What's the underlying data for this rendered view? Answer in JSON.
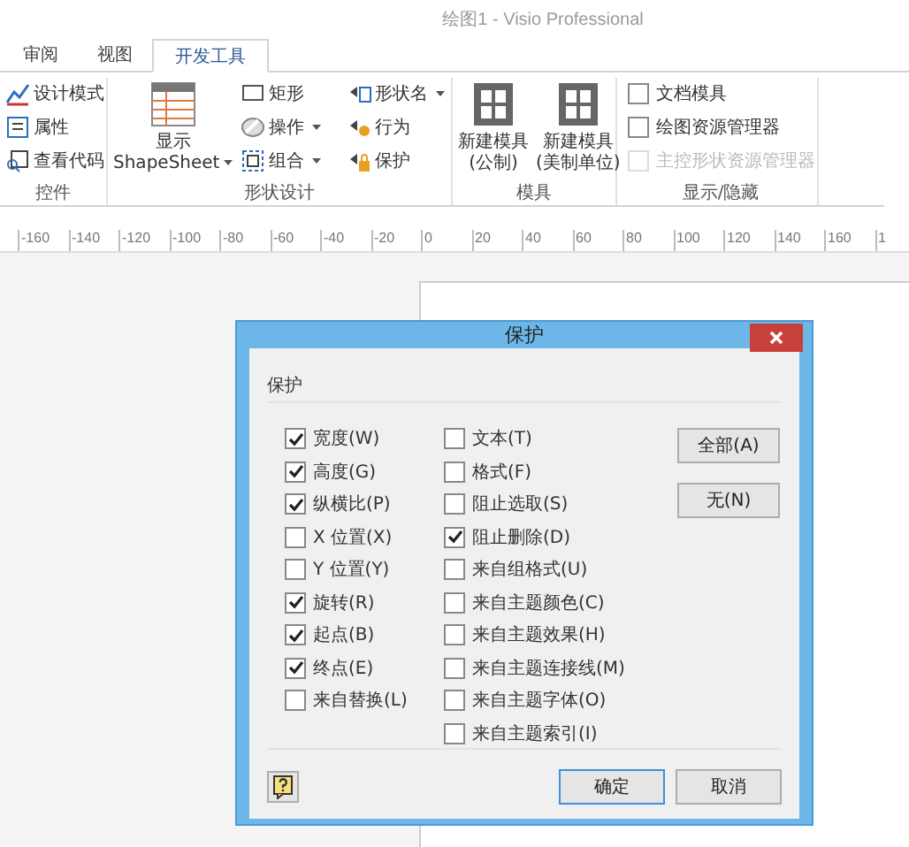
{
  "window": {
    "title": "绘图1 - Visio Professional"
  },
  "tabs": [
    {
      "label": "审阅",
      "selected": false
    },
    {
      "label": "视图",
      "selected": false
    },
    {
      "label": "开发工具",
      "selected": true
    }
  ],
  "ribbon": {
    "groups": [
      {
        "label": "控件",
        "columns": [
          [
            {
              "kind": "small",
              "label": "设计模式",
              "dropdown": false
            },
            {
              "kind": "small",
              "label": "属性",
              "dropdown": false
            },
            {
              "kind": "small",
              "label": "查看代码",
              "dropdown": false
            }
          ]
        ]
      },
      {
        "label": "形状设计",
        "columns": [
          [
            {
              "kind": "large",
              "lines": [
                "显示",
                "ShapeSheet"
              ],
              "dropdown": true
            }
          ],
          [
            {
              "kind": "small",
              "label": "矩形",
              "dropdown": false
            },
            {
              "kind": "small",
              "label": "操作",
              "dropdown": true
            },
            {
              "kind": "small",
              "label": "组合",
              "dropdown": true
            }
          ],
          [
            {
              "kind": "small",
              "label": "形状名",
              "dropdown": true
            },
            {
              "kind": "small",
              "label": "行为",
              "dropdown": false
            },
            {
              "kind": "small",
              "label": "保护",
              "dropdown": false
            }
          ]
        ]
      },
      {
        "label": "模具",
        "columns": [
          [
            {
              "kind": "large",
              "lines": [
                "新建模具",
                "(公制)"
              ],
              "dropdown": false
            }
          ],
          [
            {
              "kind": "large",
              "lines": [
                "新建模具",
                "(美制单位)"
              ],
              "dropdown": false
            }
          ]
        ]
      },
      {
        "label": "显示/隐藏",
        "columns": [
          [
            {
              "kind": "check",
              "label": "文档模具",
              "checked": false,
              "disabled": false
            },
            {
              "kind": "check",
              "label": "绘图资源管理器",
              "checked": false,
              "disabled": false
            },
            {
              "kind": "check",
              "label": "主控形状资源管理器",
              "checked": false,
              "disabled": true
            }
          ]
        ]
      }
    ]
  },
  "ruler": {
    "labels": [
      "-160",
      "-140",
      "-120",
      "-100",
      "-80",
      "-60",
      "-40",
      "-20",
      "0",
      "20",
      "40",
      "60",
      "80",
      "100",
      "120",
      "140",
      "160",
      "1"
    ]
  },
  "dialog": {
    "title": "保护",
    "group_label": "保护",
    "columns": [
      [
        {
          "label": "宽度(W)",
          "checked": true
        },
        {
          "label": "高度(G)",
          "checked": true
        },
        {
          "label": "纵横比(P)",
          "checked": true
        },
        {
          "label": "X 位置(X)",
          "checked": false
        },
        {
          "label": "Y 位置(Y)",
          "checked": false
        },
        {
          "label": "旋转(R)",
          "checked": true
        },
        {
          "label": "起点(B)",
          "checked": true
        },
        {
          "label": "终点(E)",
          "checked": true
        },
        {
          "label": "来自替换(L)",
          "checked": false
        }
      ],
      [
        {
          "label": "文本(T)",
          "checked": false
        },
        {
          "label": "格式(F)",
          "checked": false
        },
        {
          "label": "阻止选取(S)",
          "checked": false
        },
        {
          "label": "阻止删除(D)",
          "checked": true
        },
        {
          "label": "来自组格式(U)",
          "checked": false
        },
        {
          "label": "来自主题颜色(C)",
          "checked": false
        },
        {
          "label": "来自主题效果(H)",
          "checked": false
        },
        {
          "label": "来自主题连接线(M)",
          "checked": false
        },
        {
          "label": "来自主题字体(O)",
          "checked": false
        },
        {
          "label": "来自主题索引(I)",
          "checked": false
        }
      ]
    ],
    "side_buttons": [
      "全部(A)",
      "无(N)"
    ],
    "buttons": [
      {
        "label": "确定",
        "default": true
      },
      {
        "label": "取消",
        "default": false
      }
    ]
  }
}
